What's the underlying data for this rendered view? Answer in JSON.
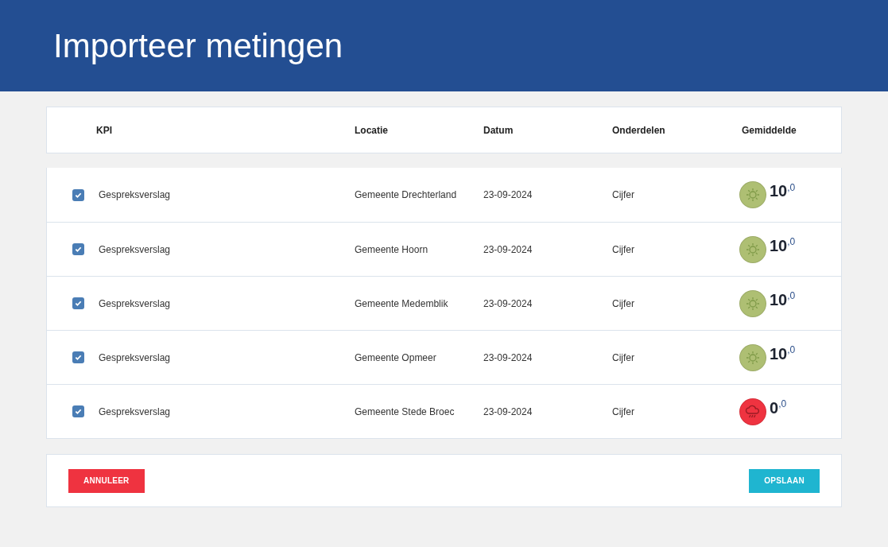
{
  "header": {
    "title": "Importeer metingen"
  },
  "table": {
    "columns": [
      "KPI",
      "Locatie",
      "Datum",
      "Onderdelen",
      "Gemiddelde"
    ],
    "rows": [
      {
        "checked": true,
        "kpi": "Gespreksverslag",
        "location": "Gemeente Drechterland",
        "date": "23-09-2024",
        "parts": "Cijfer",
        "kind": "sun",
        "color": "#aebf73",
        "score": "10$^{,0}$"
      },
      {
        "checked": true,
        "kpi": "Gespreksverslag",
        "location": "Gemeente Hoorn",
        "date": "23-09-2024",
        "parts": "Cijfer",
        "kind": "sun",
        "color": "#aebf73",
        "score": "10$^{,0}$"
      },
      {
        "checked": true,
        "kpi": "Gespreksverslag",
        "location": "Gemeente Medemblik",
        "date": "23-09-2024",
        "parts": "Cijfer",
        "kind": "sun",
        "color": "#aebf73",
        "score": "10$^{,0}$"
      },
      {
        "checked": true,
        "kpi": "Gespreksverslag",
        "location": "Gemeente Opmeer",
        "date": "23-09-2024",
        "parts": "Cijfer",
        "kind": "sun",
        "color": "#aebf73",
        "score": "10$^{,0}$"
      },
      {
        "checked": true,
        "kpi": "Gespreksverslag",
        "location": "Gemeente Stede Broec",
        "date": "23-09-2024",
        "parts": "Cijfer",
        "kind": "rain",
        "color": "#ef3340",
        "score": "0$^{,0}$"
      }
    ]
  },
  "buttons": {
    "cancel": "ANNULEER",
    "save": "OPSLAAN"
  }
}
